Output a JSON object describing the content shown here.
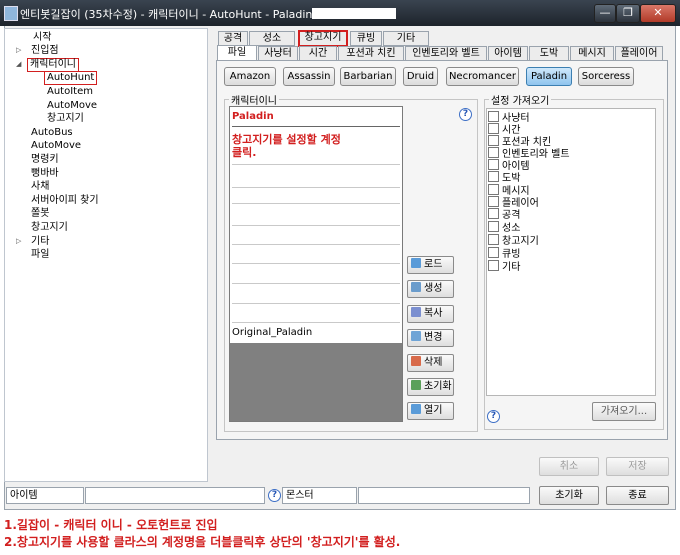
{
  "window": {
    "title": "엔티봇길잡이 (35차수정) - 캐릭터이니 - AutoHunt - Paladin - ",
    "min_label": "—",
    "restore_label": "❐",
    "close_label": "✕"
  },
  "tree": {
    "items": [
      "시작",
      "진입점",
      "캐릭터이니",
      "AutoHunt",
      "AutoItem",
      "AutoMove",
      "창고지기",
      "AutoBus",
      "AutoMove",
      "명령키",
      "뻥바바",
      "사채",
      "서버아이피 찾기",
      "쫄봇",
      "창고지기",
      "기타",
      "파일"
    ]
  },
  "tabs": {
    "row1": [
      "공격",
      "성소",
      "창고지기",
      "큐빙",
      "기타"
    ],
    "row2": [
      "파일",
      "사냥터",
      "시간",
      "포션과 치킨",
      "인벤토리와 벨트",
      "아이템",
      "도박",
      "메시지",
      "플레이어"
    ]
  },
  "classes": [
    "Amazon",
    "Assassin",
    "Barbarian",
    "Druid",
    "Necromancer",
    "Paladin",
    "Sorceress"
  ],
  "character_group": {
    "legend": "캐릭터이니",
    "rows": [
      "Paladin",
      "창고지기를 설정할 계정",
      "클릭.",
      "Original_Paladin"
    ],
    "actions": [
      "로드",
      "생성",
      "복사",
      "변경",
      "삭제",
      "초기화",
      "열기"
    ]
  },
  "settings_group": {
    "legend": "설정 가져오기",
    "options": [
      "사냥터",
      "시간",
      "포션과 치킨",
      "인벤토리와 벨트",
      "아이템",
      "도박",
      "메시지",
      "플레이어",
      "공격",
      "성소",
      "창고지기",
      "큐빙",
      "기타"
    ],
    "import_label": "가져오기...",
    "help": "?"
  },
  "footer": {
    "cancel_label": "취소",
    "save_label": "저장",
    "item_label": "아이템",
    "monster_label": "몬스터",
    "reset_label": "초기화",
    "exit_label": "종료"
  },
  "instructions": [
    "1.길잡이 - 캐릭터 이니 - 오토헌트로 진입",
    "2.창고지기를 사용할 클라스의 계정명을 더블클릭후 상단의 '창고지기'를 활성."
  ],
  "colors": {
    "accent_red": "#d21f1f",
    "selected_blue": "#8fc4ee"
  }
}
